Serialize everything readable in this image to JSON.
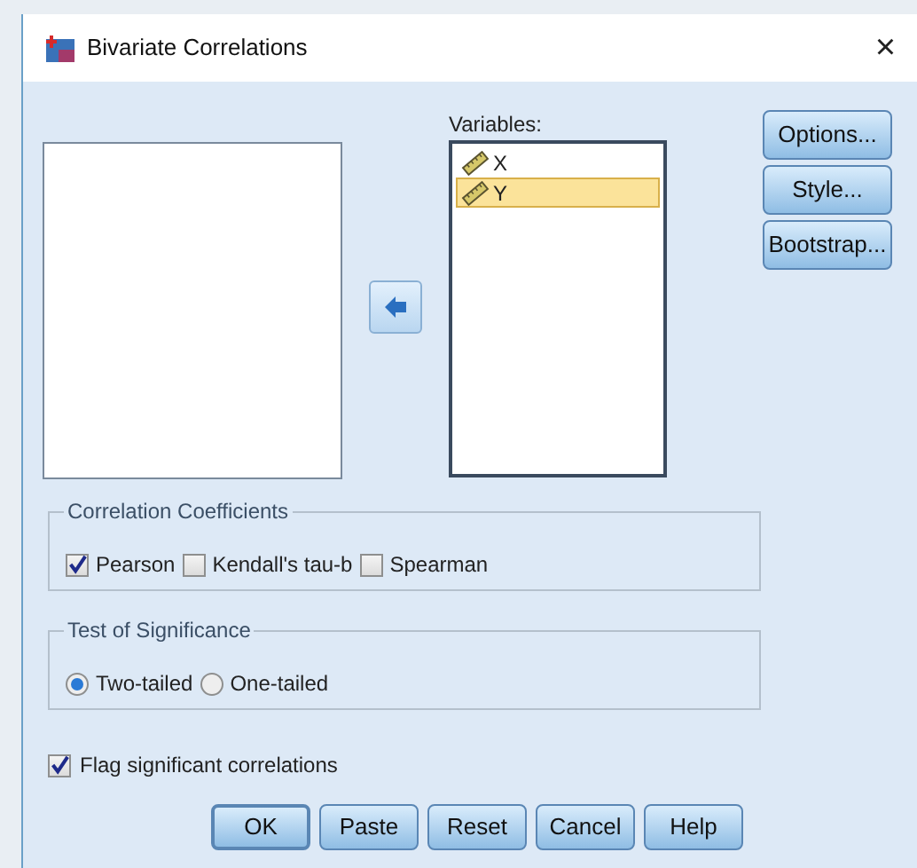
{
  "window": {
    "title": "Bivariate Correlations",
    "close": "×"
  },
  "variables": {
    "label": "Variables:",
    "items": [
      {
        "name": "X",
        "selected": false
      },
      {
        "name": "Y",
        "selected": true
      }
    ]
  },
  "side_buttons": [
    "Options...",
    "Style...",
    "Bootstrap..."
  ],
  "coefficients": {
    "title": "Correlation Coefficients",
    "options": [
      {
        "label": "Pearson",
        "checked": true
      },
      {
        "label": "Kendall's tau-b",
        "checked": false
      },
      {
        "label": "Spearman",
        "checked": false
      }
    ]
  },
  "significance": {
    "title": "Test of Significance",
    "options": [
      {
        "label": "Two-tailed",
        "selected": true
      },
      {
        "label": "One-tailed",
        "selected": false
      }
    ]
  },
  "flag": {
    "label": "Flag significant correlations",
    "checked": true
  },
  "buttons": [
    {
      "label": "OK",
      "default": true
    },
    {
      "label": "Paste",
      "default": false
    },
    {
      "label": "Reset",
      "default": false
    },
    {
      "label": "Cancel",
      "default": false
    },
    {
      "label": "Help",
      "default": false
    }
  ]
}
